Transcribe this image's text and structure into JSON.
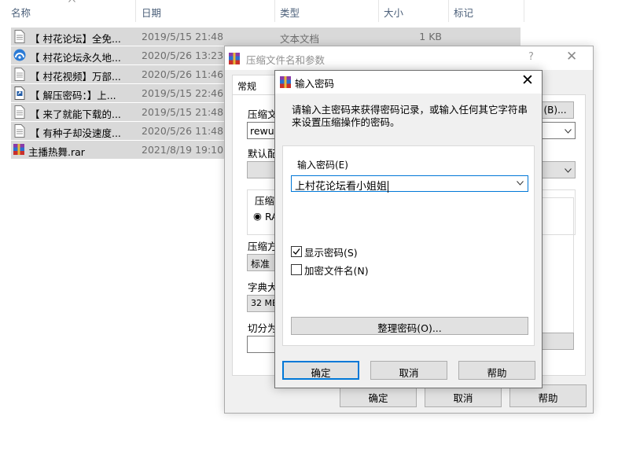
{
  "explorer": {
    "columns": {
      "name": "名称",
      "date": "日期",
      "type": "类型",
      "size": "大小",
      "tags": "标记"
    },
    "rows": [
      {
        "name": "【 村花论坛】全免...",
        "date": "2019/5/15 21:48",
        "type": "文本文档",
        "size": "1 KB",
        "icon": "text-file-icon"
      },
      {
        "name": "【 村花论坛永久地...",
        "date": "2020/5/26 13:23",
        "type": "",
        "size": "",
        "icon": "web-shortcut-icon"
      },
      {
        "name": "【 村花视频】万部...",
        "date": "2020/5/26 11:46",
        "type": "",
        "size": "",
        "icon": "text-file-icon"
      },
      {
        "name": "【 解压密码：】上...",
        "date": "2019/5/15 22:46",
        "type": "",
        "size": "",
        "icon": "shortcut-file-icon"
      },
      {
        "name": "【 来了就能下载的...",
        "date": "2019/5/15 21:48",
        "type": "",
        "size": "",
        "icon": "text-file-icon"
      },
      {
        "name": "【 有种子却没速度...",
        "date": "2020/5/26 11:48",
        "type": "",
        "size": "",
        "icon": "text-file-icon"
      },
      {
        "name": "主播热舞.rar",
        "date": "2021/8/19 19:10",
        "type": "",
        "size": "",
        "icon": "rar-archive-icon"
      }
    ]
  },
  "compress_dialog": {
    "title": "压缩文件名和参数",
    "help": "?",
    "tab_general": "常规",
    "archive_name_label": "压缩文",
    "archive_name_value": "rewu.r",
    "browse_label": "(B)...",
    "default_profile_label": "默认配",
    "format_group_label": "压缩",
    "format_rar_label": "RA",
    "method_label": "压缩方",
    "method_value": "标准",
    "dict_label": "字典大",
    "dict_value": "32 MB",
    "split_label": "切分为",
    "ok": "确定",
    "cancel": "取消",
    "help_btn": "帮助"
  },
  "password_dialog": {
    "title": "输入密码",
    "description": "请输入主密码来获得密码记录，或输入任何其它字符串来设置压缩操作的密码。",
    "password_label": "输入密码(E)",
    "password_value": "上村花论坛看小姐姐",
    "show_password_label": "显示密码(S)",
    "show_password_checked": true,
    "encrypt_names_label": "加密文件名(N)",
    "encrypt_names_checked": false,
    "manage_passwords": "整理密码(O)...",
    "ok": "确定",
    "cancel": "取消",
    "help": "帮助"
  }
}
